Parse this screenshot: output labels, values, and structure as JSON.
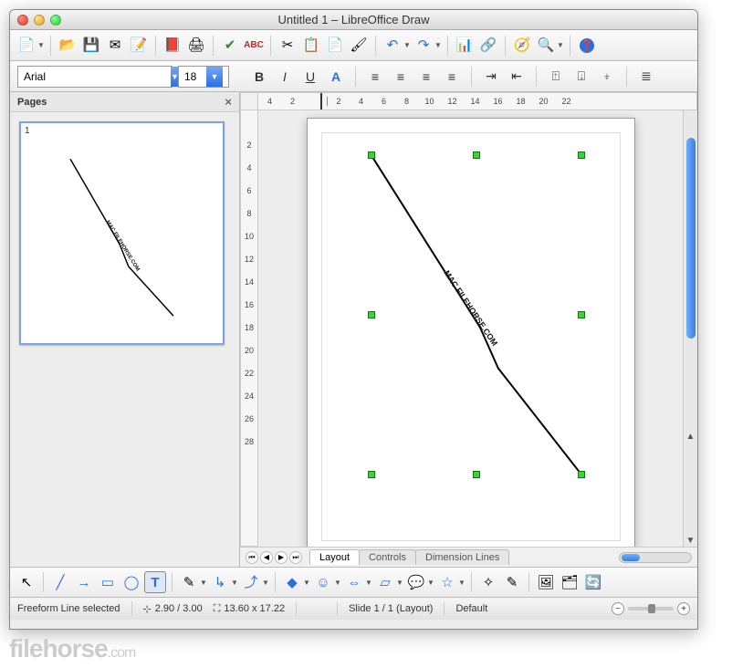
{
  "window": {
    "title": "Untitled 1 – LibreOffice Draw"
  },
  "toolbar": {
    "new": "📄",
    "open": "📂",
    "save": "💾",
    "email": "✉",
    "edit": "📝",
    "pdf": "📕",
    "print": "🖨",
    "spell": "✔",
    "cut": "✂",
    "copy": "📋",
    "paste": "📄",
    "brush": "🖌",
    "undo": "↶",
    "redo": "↷",
    "chart": "📊",
    "hyperlink": "🔗",
    "nav": "🧭",
    "zoom": "🔍",
    "help": "❓"
  },
  "format": {
    "font": "Arial",
    "size": "18",
    "bold": "B",
    "italic": "I",
    "underline": "U",
    "fontwork": "A",
    "align_left": "≡",
    "align_center": "≡",
    "align_right": "≡",
    "align_just": "≡",
    "indent_inc": "⇥",
    "indent_dec": "⇤",
    "top": "⍐",
    "middle": "⍗",
    "bottom": "⍖",
    "bullets": "≣"
  },
  "sidebar": {
    "title": "Pages",
    "page_number": "1"
  },
  "ruler": {
    "h": [
      "4",
      "2",
      "",
      "2",
      "4",
      "6",
      "8",
      "10",
      "12",
      "14",
      "16",
      "18",
      "20",
      "22"
    ],
    "v": [
      "",
      "2",
      "4",
      "6",
      "8",
      "10",
      "12",
      "14",
      "16",
      "18",
      "20",
      "22",
      "24",
      "26",
      "28"
    ]
  },
  "canvas": {
    "watermark": "MAC.FILEHORSE.COM"
  },
  "tabs": {
    "layout": "Layout",
    "controls": "Controls",
    "dimension": "Dimension Lines"
  },
  "drawbar": {
    "select": "↖",
    "line": "╱",
    "arrow": "→",
    "rect": "▭",
    "ellipse": "◯",
    "text": "T",
    "curve": "✎",
    "connector": "↳",
    "lines": "⤴",
    "shapes": "◆",
    "symbols": "☺",
    "arrows": "⇔",
    "flow": "▱",
    "call": "💬",
    "stars": "☆",
    "points": "✧",
    "glue": "✎",
    "fromfile": "🖼",
    "gallery": "🗂",
    "effects": "🔄"
  },
  "status": {
    "selection": "Freeform Line selected",
    "pos": "2.90 / 3.00",
    "size": "13.60 x 17.22",
    "slide": "Slide 1 / 1 (Layout)",
    "layout": "Default"
  },
  "brand": {
    "name": "filehorse",
    "tld": ".com"
  }
}
